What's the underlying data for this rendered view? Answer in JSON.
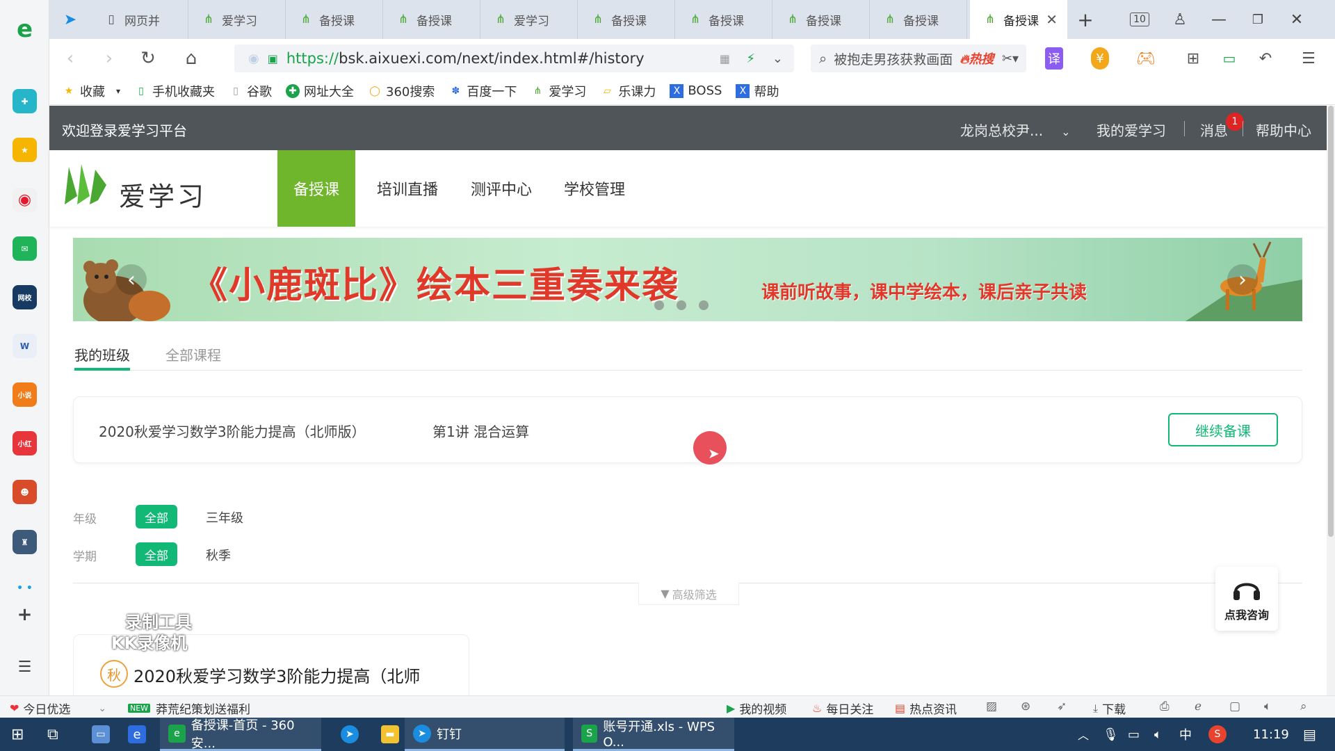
{
  "browser": {
    "tabs": [
      {
        "label": "网页并"
      },
      {
        "label": "爱学习"
      },
      {
        "label": "备授课"
      },
      {
        "label": "备授课"
      },
      {
        "label": "爱学习"
      },
      {
        "label": "备授课"
      },
      {
        "label": "备授课"
      },
      {
        "label": "备授课"
      },
      {
        "label": "备授课"
      },
      {
        "label": "备授课"
      }
    ],
    "tab_count": "10",
    "url_scheme": "https://",
    "url_rest": "bsk.aixuexi.com/next/index.html#/history",
    "hot_search": "被抱走男孩获救画面",
    "hot_label": "热搜",
    "bookmarks": [
      "收藏",
      "手机收藏夹",
      "谷歌",
      "网址大全",
      "360搜索",
      "百度一下",
      "爱学习",
      "乐课力",
      "BOSS",
      "帮助"
    ]
  },
  "site": {
    "welcome": "欢迎登录爱学习平台",
    "user_name": "龙岗总校尹...",
    "my_link": "我的爱学习",
    "messages": "消息",
    "message_count": "1",
    "help_center": "帮助中心",
    "logo_text": "爱学习",
    "nav": [
      "备授课",
      "培训直播",
      "测评中心",
      "学校管理"
    ],
    "accent_color": "#12b876",
    "nav_active_color": "#70b62d"
  },
  "banner": {
    "title": "《小鹿斑比》绘本三重奏来袭",
    "subtitle": "课前听故事，课中学绘本，课后亲子共读"
  },
  "content_tabs": [
    "我的班级",
    "全部课程"
  ],
  "recent_class": {
    "name": "2020秋爱学习数学3阶能力提高（北师版）",
    "lesson": "第1讲 混合运算",
    "button": "继续备课"
  },
  "filters": {
    "grade_label": "年级",
    "grade_all": "全部",
    "grade_option": "三年级",
    "term_label": "学期",
    "term_all": "全部",
    "term_option": "秋季",
    "advanced": "高级筛选"
  },
  "consult": "点我咨询",
  "course_card": {
    "season": "秋",
    "title": "2020秋爱学习数学3阶能力提高（北师"
  },
  "watermark": [
    "录制工具",
    "KK录像机"
  ],
  "status_bar": {
    "today": "今日优选",
    "new_badge": "NEW",
    "promo": "莽荒纪策划送福利",
    "items": [
      "我的视频",
      "每日关注",
      "热点资讯",
      "下载"
    ]
  },
  "taskbar": {
    "items": [
      "备授课-首页 - 360安...",
      "钉钉",
      "账号开通.xls - WPS O..."
    ],
    "ime": "中",
    "time": "11:19"
  }
}
